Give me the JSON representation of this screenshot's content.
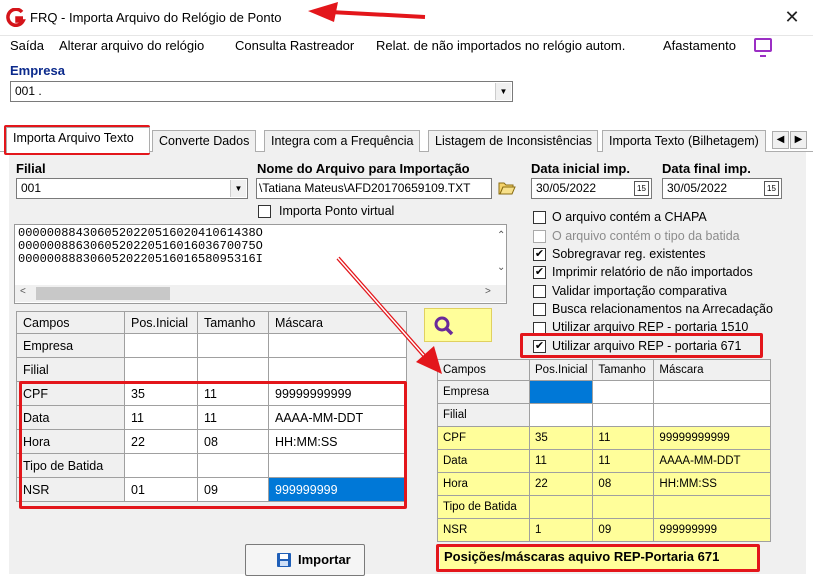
{
  "window": {
    "title": "FRQ - Importa Arquivo do Relógio de Ponto",
    "close": "✕"
  },
  "menu": [
    "Saída",
    "Alterar arquivo do relógio",
    "Consulta Rastreador",
    "Relat. de não importados no relógio autom.",
    "Afastamento"
  ],
  "empresa": {
    "label": "Empresa",
    "value": "001 ."
  },
  "tabs": [
    "Importa Arquivo Texto",
    "Converte Dados",
    "Integra com a Frequência",
    "Listagem de Inconsistências",
    "Importa Texto (Bilhetagem)"
  ],
  "filial": {
    "label": "Filial",
    "value": "001"
  },
  "arquivo": {
    "label": "Nome do Arquivo para Importação",
    "value": "\\Tatiana Mateus\\AFD20170659109.TXT"
  },
  "data_inicial": {
    "label": "Data inicial imp.",
    "value": "30/05/2022"
  },
  "data_final": {
    "label": "Data final imp.",
    "value": "30/05/2022"
  },
  "ponto_virtual": "Importa Ponto virtual",
  "memo_lines": [
    "000000884306052022051602041061438O",
    "000000886306052022051601603670075O",
    "000000888306052022051601658095316I"
  ],
  "options": [
    {
      "label": "O arquivo contém a CHAPA",
      "checked": false,
      "disabled": false
    },
    {
      "label": "O arquivo contém o tipo da batida",
      "checked": false,
      "disabled": true
    },
    {
      "label": "Sobregravar reg. existentes",
      "checked": true,
      "disabled": false
    },
    {
      "label": "Imprimir relatório de não importados",
      "checked": true,
      "disabled": false
    },
    {
      "label": "Validar importação comparativa",
      "checked": false,
      "disabled": false
    },
    {
      "label": "Busca relacionamentos na Arrecadação",
      "checked": false,
      "disabled": false
    },
    {
      "label": "Utilizar arquivo REP - portaria 1510",
      "checked": false,
      "disabled": false
    },
    {
      "label": "Utilizar arquivo REP - portaria 671",
      "checked": true,
      "disabled": false
    }
  ],
  "grid_headers": [
    "Campos",
    "Pos.Inicial",
    "Tamanho",
    "Máscara"
  ],
  "grid1_rows": [
    [
      "Empresa",
      "",
      "",
      ""
    ],
    [
      "Filial",
      "",
      "",
      ""
    ],
    [
      "CPF",
      "35",
      "11",
      "99999999999"
    ],
    [
      "Data",
      "11",
      "11",
      "AAAA-MM-DDT"
    ],
    [
      "Hora",
      "22",
      "08",
      "HH:MM:SS"
    ],
    [
      "Tipo de Batida",
      "",
      "",
      ""
    ],
    [
      "NSR",
      "01",
      "09",
      "999999999"
    ]
  ],
  "grid2_rows": [
    [
      "Empresa",
      "",
      "",
      ""
    ],
    [
      "Filial",
      "",
      "",
      ""
    ],
    [
      "CPF",
      "35",
      "11",
      "99999999999"
    ],
    [
      "Data",
      "11",
      "11",
      "AAAA-MM-DDT"
    ],
    [
      "Hora",
      "22",
      "08",
      "HH:MM:SS"
    ],
    [
      "Tipo de Batida",
      "",
      "",
      ""
    ],
    [
      "NSR",
      "1",
      "09",
      "999999999"
    ]
  ],
  "import_button": "Importar",
  "caption": "Posições/máscaras  aquivo REP-Portaria 671",
  "colors": {
    "accent_red": "#e3161b",
    "highlight_yellow": "#fffe9a",
    "selection_blue": "#0078d7"
  }
}
